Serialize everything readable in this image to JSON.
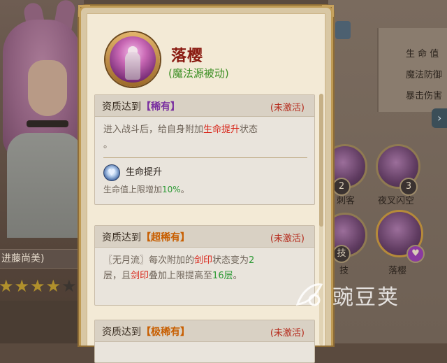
{
  "background": {
    "character_name": "进藤尚美)",
    "stars_filled": 4,
    "stars_total": 6,
    "right_stats": [
      "生 命 值",
      "魔法防御",
      "暴击伤害"
    ],
    "skills": [
      {
        "label": "刺客",
        "badge": "2"
      },
      {
        "label": "夜叉闪空",
        "badge": "3"
      },
      {
        "label": "技",
        "badge": "技"
      },
      {
        "label": "落樱",
        "badge": ""
      }
    ]
  },
  "popup": {
    "skill_name": "落樱",
    "skill_type": "(魔法源被动)",
    "cards": [
      {
        "prefix": "资质达到",
        "rarity": "【稀有】",
        "status": "(未激活)",
        "desc_parts": [
          "进入战斗后，给自身附加",
          "生命提升",
          "状态",
          "。"
        ],
        "buff_name": "生命提升",
        "buff_desc_parts": [
          "生命值上限增加",
          "10%",
          "。"
        ]
      },
      {
        "prefix": "资质达到",
        "rarity": "【超稀有】",
        "status": "(未激活)",
        "desc_parts": [
          "〖无月流〗每次附加的",
          "剑印",
          "状态变为",
          "2",
          "层，且",
          "剑印",
          "叠加上限提高至",
          "16层",
          "。"
        ]
      },
      {
        "prefix": "资质达到",
        "rarity": "【极稀有】",
        "status": "(未激活)"
      }
    ]
  },
  "watermark": {
    "text": "豌豆荚"
  },
  "colors": {
    "title_red": "#8a1b12",
    "type_green": "#3c8f24",
    "highlight_red": "#d8261a",
    "highlight_green": "#2e9a36",
    "rarity_purple": "#7a2fa0",
    "rarity_orange": "#c85e00",
    "status_red": "#b52a1c"
  }
}
